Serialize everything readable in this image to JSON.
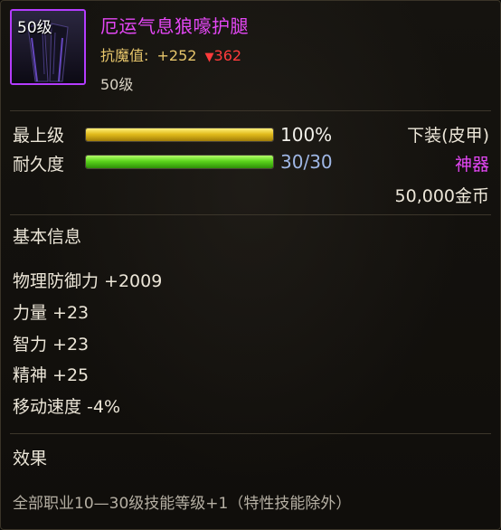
{
  "item": {
    "icon_level": "50级",
    "name": "厄运气息狼嚎护腿",
    "resist_label": "抗魔值:",
    "resist_plus": "+252",
    "resist_down_icon": "down-triangle-icon",
    "resist_down_value": "362",
    "required_level": "50级"
  },
  "bars": {
    "upgrade": {
      "label": "最上级",
      "value_text": "100%",
      "fill_percent": 100,
      "color": "#e2bc1c"
    },
    "durability": {
      "label": "耐久度",
      "value_text": "30/30",
      "fill_percent": 100,
      "color": "#5bd41c"
    }
  },
  "right_info": {
    "slot_type": "下装(皮甲)",
    "rarity": "神器",
    "rarity_color": "#e447f5",
    "price": "50,000金币"
  },
  "basic_info": {
    "title": "基本信息",
    "attributes": [
      "物理防御力 +2009",
      "力量 +23",
      "智力 +23",
      "精神 +25",
      "移动速度 -4%"
    ]
  },
  "effect": {
    "title": "效果",
    "text": "全部职业10—30级技能等级+1（特性技能除外）"
  }
}
